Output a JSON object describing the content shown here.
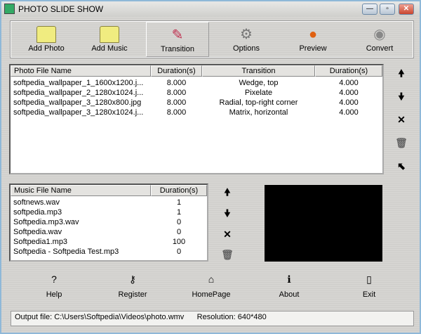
{
  "window": {
    "title": "PHOTO SLIDE SHOW",
    "minimize": "—",
    "maximize": "▫",
    "close": "✕"
  },
  "toolbar": [
    {
      "label": "Add Photo",
      "icon": "folder-icon"
    },
    {
      "label": "Add Music",
      "icon": "folder-icon"
    },
    {
      "label": "Transition",
      "icon": "pencils-icon"
    },
    {
      "label": "Options",
      "icon": "gear-icon"
    },
    {
      "label": "Preview",
      "icon": "pumpkin-icon"
    },
    {
      "label": "Convert",
      "icon": "disc-film-icon"
    }
  ],
  "photos": {
    "headers": [
      "Photo File Name",
      "Duration(s)",
      "Transition",
      "Duration(s)"
    ],
    "rows": [
      [
        "softpedia_wallpaper_1_1600x1200.j...",
        "8.000",
        "Wedge, top",
        "4.000"
      ],
      [
        "softpedia_wallpaper_2_1280x1024.j...",
        "8.000",
        "Pixelate",
        "4.000"
      ],
      [
        "softpedia_wallpaper_3_1280x800.jpg",
        "8.000",
        "Radial, top-right corner",
        "4.000"
      ],
      [
        "softpedia_wallpaper_3_1280x1024.j...",
        "8.000",
        "Matrix, horizontal",
        "4.000"
      ]
    ]
  },
  "music": {
    "headers": [
      "Music File Name",
      "Duration(s)"
    ],
    "rows": [
      [
        "softnews.wav",
        "1"
      ],
      [
        "softpedia.mp3",
        "1"
      ],
      [
        "Softpedia.mp3.wav",
        "0"
      ],
      [
        "Softpedia.wav",
        "0"
      ],
      [
        "Softpedia1.mp3",
        "100"
      ],
      [
        "Softpedia - Softpedia Test.mp3",
        "0"
      ]
    ]
  },
  "side_icons": {
    "up": "🠝",
    "down": "🠟",
    "delete": "✕",
    "clear": "🗑",
    "set": "⬉"
  },
  "bottom": [
    {
      "label": "Help",
      "icon": "?"
    },
    {
      "label": "Register",
      "icon": "⚷"
    },
    {
      "label": "HomePage",
      "icon": "⌂"
    },
    {
      "label": "About",
      "icon": "ℹ"
    },
    {
      "label": "Exit",
      "icon": "▯"
    }
  ],
  "status": {
    "output": "Output file: C:\\Users\\Softpedia\\Videos\\photo.wmv",
    "resolution": "Resolution: 640*480"
  }
}
